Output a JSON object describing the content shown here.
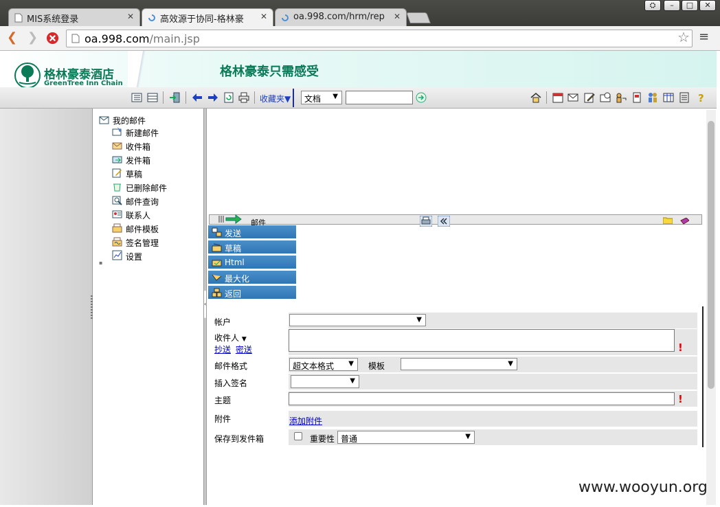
{
  "browser": {
    "tabs": [
      {
        "title": "MIS系统登录",
        "active": false
      },
      {
        "title": "高效源于协同-格林豪",
        "active": true
      },
      {
        "title": "oa.998.com/hrm/rep",
        "active": false
      }
    ],
    "url_host": "oa.998.com",
    "url_path": "/main.jsp",
    "window_buttons": [
      "minimize",
      "maximize",
      "close"
    ]
  },
  "header": {
    "logo_cn": "格林豪泰酒店",
    "logo_en": "GreenTree Inn Chain",
    "logo_seal": "GreenTree Inn.",
    "slogan": "格林豪泰只需感受"
  },
  "toolbar": {
    "favorites_label": "收藏夹▼",
    "doc_select": "文档",
    "search_value": ""
  },
  "tree": {
    "root": "我的邮件",
    "items": [
      "新建邮件",
      "收件箱",
      "发件箱",
      "草稿",
      "已删除邮件",
      "邮件查询",
      "联系人",
      "邮件模板",
      "签名管理",
      "设置"
    ]
  },
  "mailbar": {
    "title": "邮件"
  },
  "actions": [
    {
      "label": "发送"
    },
    {
      "label": "草稿"
    },
    {
      "label": "Html"
    },
    {
      "label": "最大化"
    },
    {
      "label": "返回"
    }
  ],
  "form": {
    "account_label": "帐户",
    "recipient_label": "收件人",
    "cc_link": "抄送",
    "bcc_link": "密送",
    "format_label": "邮件格式",
    "format_value": "超文本格式",
    "template_label": "模板",
    "signature_label": "插入签名",
    "subject_label": "主题",
    "attach_label": "附件",
    "attach_link": "添加附件",
    "save_label": "保存到发件箱",
    "importance_label": "重要性",
    "importance_value": "普通"
  },
  "watermark": "www.wooyun.org",
  "colors": {
    "accent_green": "#0b7a57",
    "menu_blue": "#3a82c0",
    "required_red": "#e00000"
  }
}
